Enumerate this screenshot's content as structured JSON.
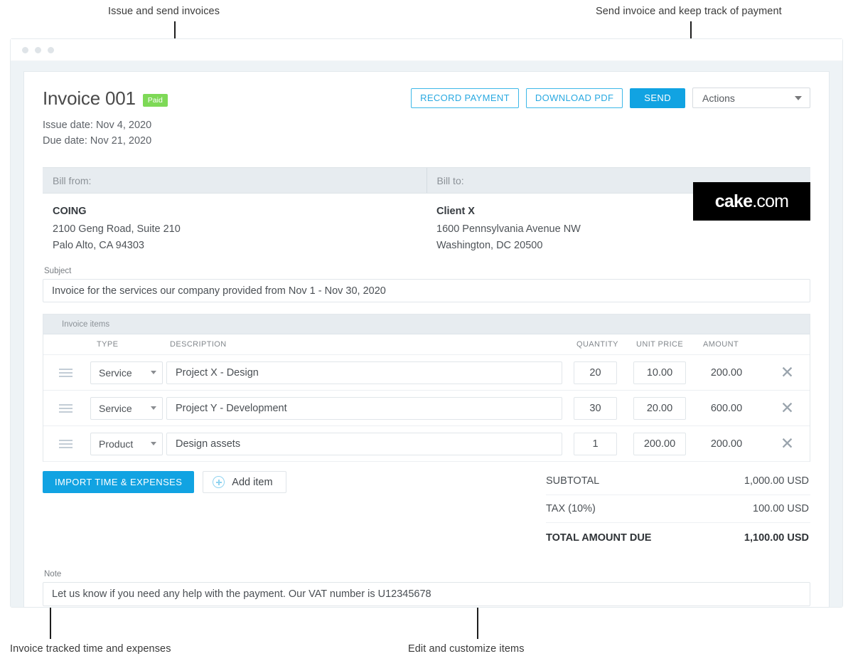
{
  "annotations": [
    {
      "id": "issue-send",
      "text": "Issue and send invoices"
    },
    {
      "id": "send-track",
      "text": "Send invoice and keep track of payment"
    },
    {
      "id": "import-time",
      "text": "Invoice tracked time and expenses"
    },
    {
      "id": "edit-items",
      "text": "Edit and customize items"
    }
  ],
  "window": {
    "dots": [
      "close-dot",
      "minimize-dot",
      "maximize-dot"
    ]
  },
  "invoice": {
    "title": "Invoice 001",
    "status_badge": "Paid",
    "issue_date": "Issue date: Nov 4, 2020",
    "due_date": "Due date: Nov 21, 2020",
    "logo": {
      "bold": "cake",
      "light": ".com"
    },
    "toolbar": {
      "record_payment": "RECORD PAYMENT",
      "download_pdf": "DOWNLOAD PDF",
      "send": "SEND",
      "actions_select": "Actions"
    },
    "bill_from": {
      "heading": "Bill from:",
      "name": "COING",
      "line1": "2100 Geng Road, Suite 210",
      "line2": "Palo Alto, CA 94303"
    },
    "bill_to": {
      "heading": "Bill to:",
      "name": "Client X",
      "line1": "1600 Pennsylvania Avenue NW",
      "line2": "Washington, DC 20500"
    },
    "subject": {
      "label": "Subject",
      "value": "Invoice for the services our company provided from Nov 1 - Nov 30, 2020"
    },
    "items_section_label": "Invoice items",
    "columns": {
      "type": "TYPE",
      "description": "DESCRIPTION",
      "quantity": "QUANTITY",
      "unit_price": "UNIT PRICE",
      "amount": "AMOUNT"
    },
    "items": [
      {
        "type": "Service",
        "description": "Project X - Design",
        "quantity": "20",
        "unit_price": "10.00",
        "amount": "200.00"
      },
      {
        "type": "Service",
        "description": "Project Y - Development",
        "quantity": "30",
        "unit_price": "20.00",
        "amount": "600.00"
      },
      {
        "type": "Product",
        "description": "Design assets",
        "quantity": "1",
        "unit_price": "200.00",
        "amount": "200.00"
      }
    ],
    "buttons": {
      "import_time_expenses": "IMPORT TIME & EXPENSES",
      "add_item": "Add item"
    },
    "totals": [
      {
        "label": "SUBTOTAL",
        "value": "1,000.00 USD"
      },
      {
        "label": "TAX  (10%)",
        "value": "100.00 USD"
      },
      {
        "label": "TOTAL AMOUNT DUE",
        "value": "1,100.00 USD"
      }
    ],
    "note": {
      "label": "Note",
      "value": "Let us know if you need any help with the payment. Our VAT number is U12345678"
    }
  },
  "colors": {
    "accent": "#11a3e2",
    "accent_outline": "#3db8e8",
    "badge_green": "#7ed957",
    "header_strip": "#e7ecf0",
    "page_bg": "#eef3f6"
  }
}
